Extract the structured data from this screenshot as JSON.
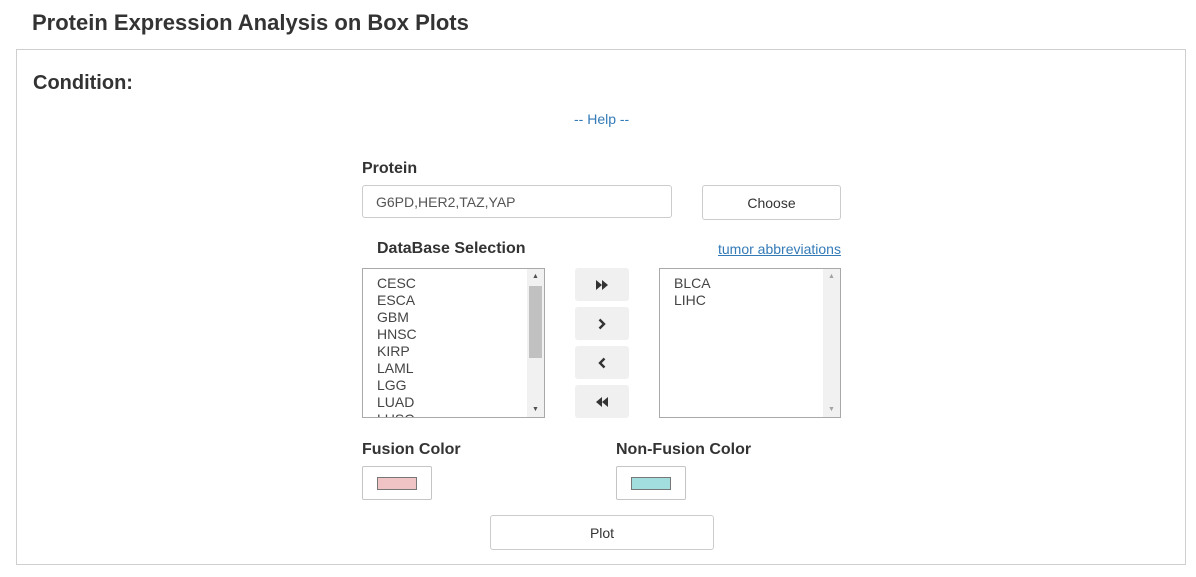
{
  "page": {
    "title": "Protein Expression Analysis on Box Plots"
  },
  "condition": {
    "title": "Condition:",
    "help_link": "-- Help --",
    "protein": {
      "label": "Protein",
      "value": "G6PD,HER2,TAZ,YAP",
      "choose_label": "Choose"
    },
    "database": {
      "label": "DataBase Selection",
      "abbrev_link": "tumor abbreviations",
      "available": [
        "CESC",
        "ESCA",
        "GBM",
        "HNSC",
        "KIRP",
        "LAML",
        "LGG",
        "LUAD",
        "LUSC"
      ],
      "selected": [
        "BLCA",
        "LIHC"
      ],
      "buttons": {
        "add_all": "double-chevron-right-icon",
        "add": "chevron-right-icon",
        "remove": "chevron-left-icon",
        "remove_all": "double-chevron-left-icon"
      }
    },
    "fusion_color": {
      "label": "Fusion Color",
      "color": "#f0c4c4"
    },
    "non_fusion_color": {
      "label": "Non-Fusion Color",
      "color": "#a3dede"
    },
    "plot_label": "Plot"
  },
  "colors": {
    "link": "#337ab7",
    "border": "#cfcfcf",
    "button_bg": "#f0f0f0"
  }
}
